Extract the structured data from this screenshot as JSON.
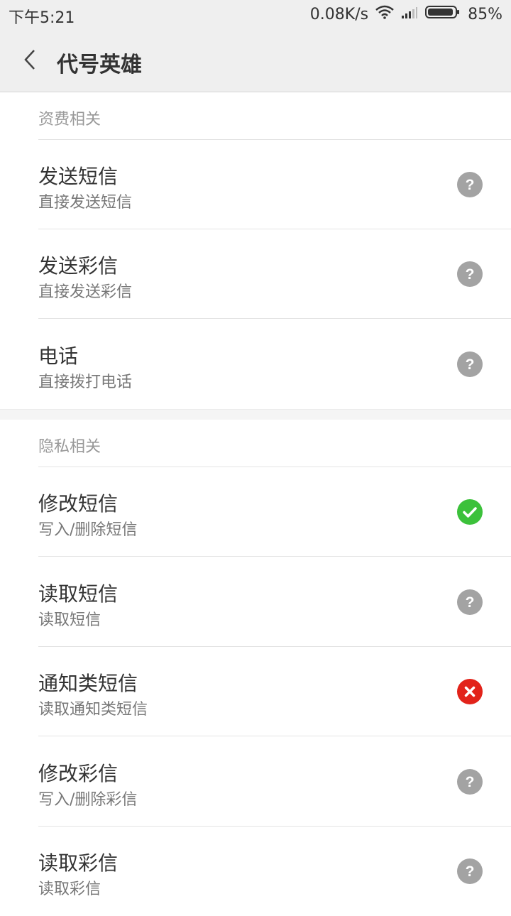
{
  "status_bar": {
    "time": "下午5:21",
    "net_speed": "0.08K/s",
    "battery": "85%"
  },
  "header": {
    "title": "代号英雄"
  },
  "sections": [
    {
      "title": "资费相关",
      "items": [
        {
          "title": "发送短信",
          "subtitle": "直接发送短信",
          "status": "ask"
        },
        {
          "title": "发送彩信",
          "subtitle": "直接发送彩信",
          "status": "ask"
        },
        {
          "title": "电话",
          "subtitle": "直接拨打电话",
          "status": "ask"
        }
      ]
    },
    {
      "title": "隐私相关",
      "items": [
        {
          "title": "修改短信",
          "subtitle": "写入/删除短信",
          "status": "allow"
        },
        {
          "title": "读取短信",
          "subtitle": "读取短信",
          "status": "ask"
        },
        {
          "title": "通知类短信",
          "subtitle": "读取通知类短信",
          "status": "deny"
        },
        {
          "title": "修改彩信",
          "subtitle": "写入/删除彩信",
          "status": "ask"
        },
        {
          "title": "读取彩信",
          "subtitle": "读取彩信",
          "status": "ask"
        }
      ]
    }
  ],
  "colors": {
    "ask": "#a3a3a3",
    "allow": "#3cc13b",
    "deny": "#e2231a"
  }
}
